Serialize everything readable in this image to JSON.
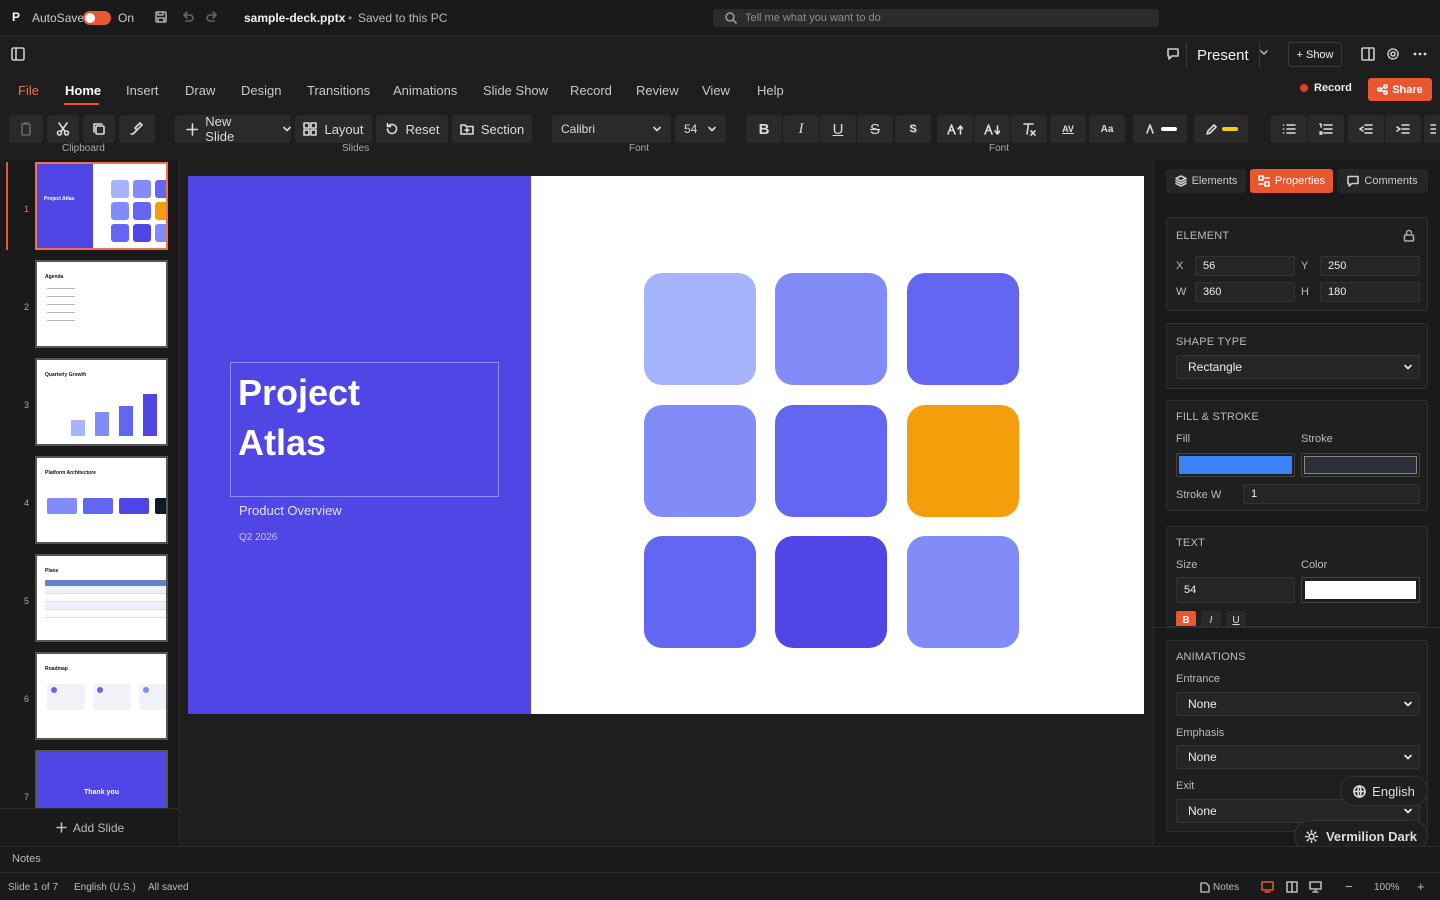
{
  "titlebar": {
    "logo": "P",
    "autosave_label": "AutoSave",
    "autosave_state": "On",
    "file_name": "sample-deck.pptx",
    "separator": "•",
    "save_status": "Saved to this PC",
    "search_placeholder": "Tell me what you want to do"
  },
  "actions": {
    "present_label": "Present",
    "show_label": "+ Show",
    "record_label": "Record",
    "share_label": "Share"
  },
  "tabs": [
    "File",
    "Home",
    "Insert",
    "Draw",
    "Design",
    "Transitions",
    "Animations",
    "Slide Show",
    "Record",
    "Review",
    "View",
    "Help"
  ],
  "active_tab": "Home",
  "ribbon": {
    "clipboard_label": "Clipboard",
    "new_slide_label": "New Slide",
    "layout_label": "Layout",
    "reset_label": "Reset",
    "section_label": "Section",
    "slides_label": "Slides",
    "font_name": "Calibri",
    "font_size": "54",
    "font_label": "Font",
    "font_label_2": "Font",
    "bold_glyph": "B",
    "italic_glyph": "I",
    "underline_glyph": "U",
    "strike_glyph": "S",
    "shadow_glyph": "S",
    "spacing_glyph": "AV",
    "case_glyph": "Aa",
    "highlight_color": "#ffffff",
    "pen_color": "#facc15"
  },
  "thumbnails": [
    {
      "num": "1",
      "title": "Project Atlas"
    },
    {
      "num": "2",
      "title": "Agenda"
    },
    {
      "num": "3",
      "title": "Quarterly Growth"
    },
    {
      "num": "4",
      "title": "Platform Architecture"
    },
    {
      "num": "5",
      "title": "Plans"
    },
    {
      "num": "6",
      "title": "Roadmap"
    },
    {
      "num": "7",
      "title": "Thank you"
    }
  ],
  "add_slide_label": "Add Slide",
  "slide": {
    "title": "Project\nAtlas",
    "subtitle": "Product Overview",
    "date": "Q2 2026",
    "tile_colors": [
      "#a5b4fc",
      "#818cf8",
      "#6366f1",
      "#818cf8",
      "#6366f1",
      "#f59e0b",
      "#6366f1",
      "#4f46e5",
      "#818cf8"
    ]
  },
  "panel": {
    "tabs": {
      "elements": "Elements",
      "properties": "Properties",
      "comments": "Comments"
    },
    "element": {
      "title": "ELEMENT",
      "x_label": "X",
      "x": "56",
      "y_label": "Y",
      "y": "250",
      "w_label": "W",
      "w": "360",
      "h_label": "H",
      "h": "180"
    },
    "shape_type": {
      "title": "SHAPE TYPE",
      "value": "Rectangle"
    },
    "fill_stroke": {
      "title": "FILL & STROKE",
      "fill_label": "Fill",
      "stroke_label": "Stroke",
      "fill_color": "#3b82f6",
      "stroke_color": "#2a2f3a",
      "stroke_w_label": "Stroke W",
      "stroke_w": "1"
    },
    "text": {
      "title": "TEXT",
      "size_label": "Size",
      "size": "54",
      "color_label": "Color",
      "color": "#ffffff",
      "bold": "B",
      "italic": "I",
      "underline": "U"
    },
    "animations": {
      "title": "ANIMATIONS",
      "entrance_label": "Entrance",
      "entrance": "None",
      "emphasis_label": "Emphasis",
      "emphasis": "None",
      "exit_label": "Exit",
      "exit": "None"
    }
  },
  "floating": {
    "language": "English",
    "theme": "Vermilion Dark"
  },
  "notes_label": "Notes",
  "status": {
    "slide_of": "Slide 1 of 7",
    "language": "English (U.S.)",
    "saved": "All saved",
    "notes": "Notes",
    "zoom": "100%",
    "minus": "−",
    "plus": "+"
  }
}
